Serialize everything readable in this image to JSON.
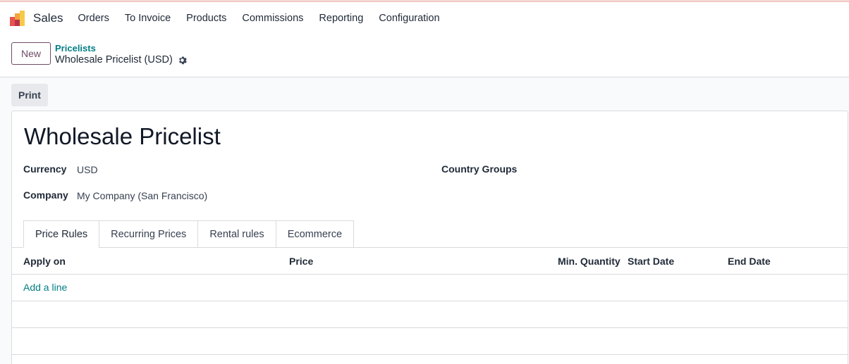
{
  "navbar": {
    "app_name": "Sales",
    "menu": [
      "Orders",
      "To Invoice",
      "Products",
      "Commissions",
      "Reporting",
      "Configuration"
    ]
  },
  "control_panel": {
    "new_label": "New",
    "breadcrumb_parent": "Pricelists",
    "breadcrumb_current": "Wholesale Pricelist (USD)"
  },
  "statusbar": {
    "print_label": "Print"
  },
  "form": {
    "title": "Wholesale Pricelist",
    "currency_label": "Currency",
    "currency_value": "USD",
    "company_label": "Company",
    "company_value": "My Company (San Francisco)",
    "country_groups_label": "Country Groups",
    "tabs": [
      "Price Rules",
      "Recurring Prices",
      "Rental rules",
      "Ecommerce"
    ],
    "table": {
      "columns": [
        "Apply on",
        "Price",
        "Min. Quantity",
        "Start Date",
        "End Date"
      ],
      "add_line": "Add a line"
    }
  },
  "colors": {
    "brand": "#714b67",
    "link": "#017e84",
    "border": "#d8dadd"
  }
}
